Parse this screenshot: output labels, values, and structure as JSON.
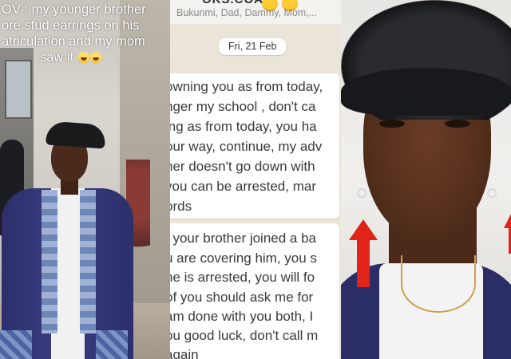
{
  "left_panel": {
    "caption_lines": [
      "OV : my younger brother",
      "ore stud earrings on his",
      "atriculation and my mom",
      "saw it"
    ]
  },
  "middle_panel": {
    "contact_name": "OKS.COA",
    "members": "Bukunmi, Dad, Dammy, Mom,...",
    "date_chip": "Fri, 21 Feb",
    "message1_lines": [
      "owning you as from today,",
      "nger my school , don't ca",
      "ing as from today, you ha",
      "our way, continue, my adv",
      "her doesn't go down with",
      "you can be arrested, mar",
      "ords"
    ],
    "message2_lines": [
      ", your brother joined a ba",
      "u are covering him, you s",
      "he is arrested, you will fo",
      "of you should ask me for",
      "am done with you both, I",
      "ou good luck, don't call m",
      "again"
    ]
  },
  "right_panel": {
    "arrow_color": "#e2231a"
  },
  "colors": {
    "chat_bg": "#ebe4d8",
    "bubble_bg": "#ffffff",
    "gown": "#2c2f6b"
  }
}
